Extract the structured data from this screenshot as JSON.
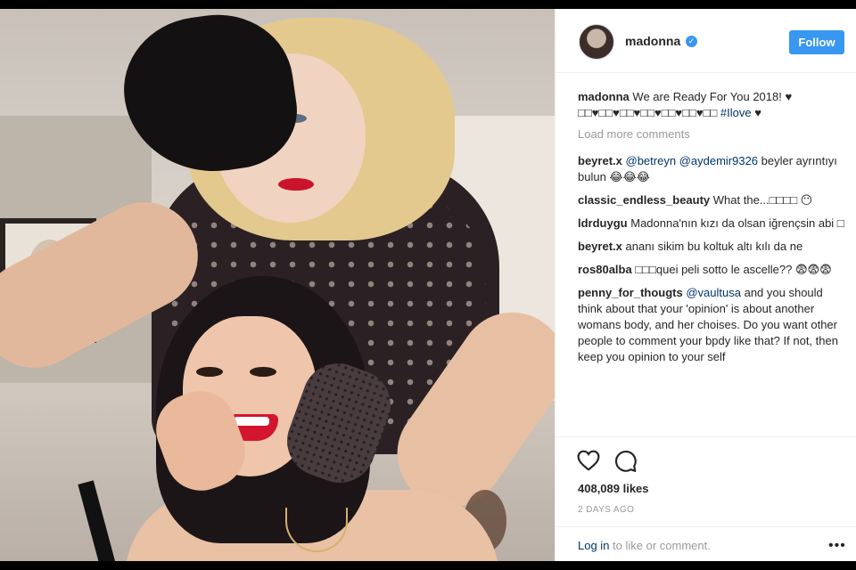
{
  "post": {
    "username": "madonna",
    "verified_icon": "verified-badge-icon",
    "follow_label": "Follow",
    "caption_user": "madonna",
    "caption_text": "We are Ready For You 2018! ♥ □□♥□□♥□□♥□□♥□□♥□□♥□□",
    "caption_tag": "#Ilove",
    "caption_end": " ♥",
    "load_more": "Load more comments",
    "comments": [
      {
        "user": "beyret.x",
        "mention1": "@betreyn",
        "mention2": "@aydemir9326",
        "text": " beyler ayrıntıyı bulun 😂😂😂"
      },
      {
        "user": "classic_endless_beauty",
        "text": "What the...□□□□ 😶"
      },
      {
        "user": "ldrduygu",
        "text": "Madonna'nın kızı da olsan iğrençsin abi □"
      },
      {
        "user": "beyret.x",
        "text": "ananı sikim bu koltuk altı kılı da ne"
      },
      {
        "user": "ros80alba",
        "text": "□□□quei peli sotto le ascelle?? 😨😨😨"
      },
      {
        "user": "penny_for_thougts",
        "mention1": "@vaultusa",
        "text": " and you should think about that your 'opinion' is about another womans body, and her choises. Do you want other people to comment your bpdy like that? If not, then keep you opinion to your self"
      }
    ],
    "likes": "408,089 likes",
    "time_ago": "2 DAYS AGO",
    "login_link": "Log in",
    "login_text": " to like or comment.",
    "more_icon": "•••"
  },
  "colors": {
    "accent": "#3897f0",
    "link": "#003569",
    "muted": "#999999"
  }
}
